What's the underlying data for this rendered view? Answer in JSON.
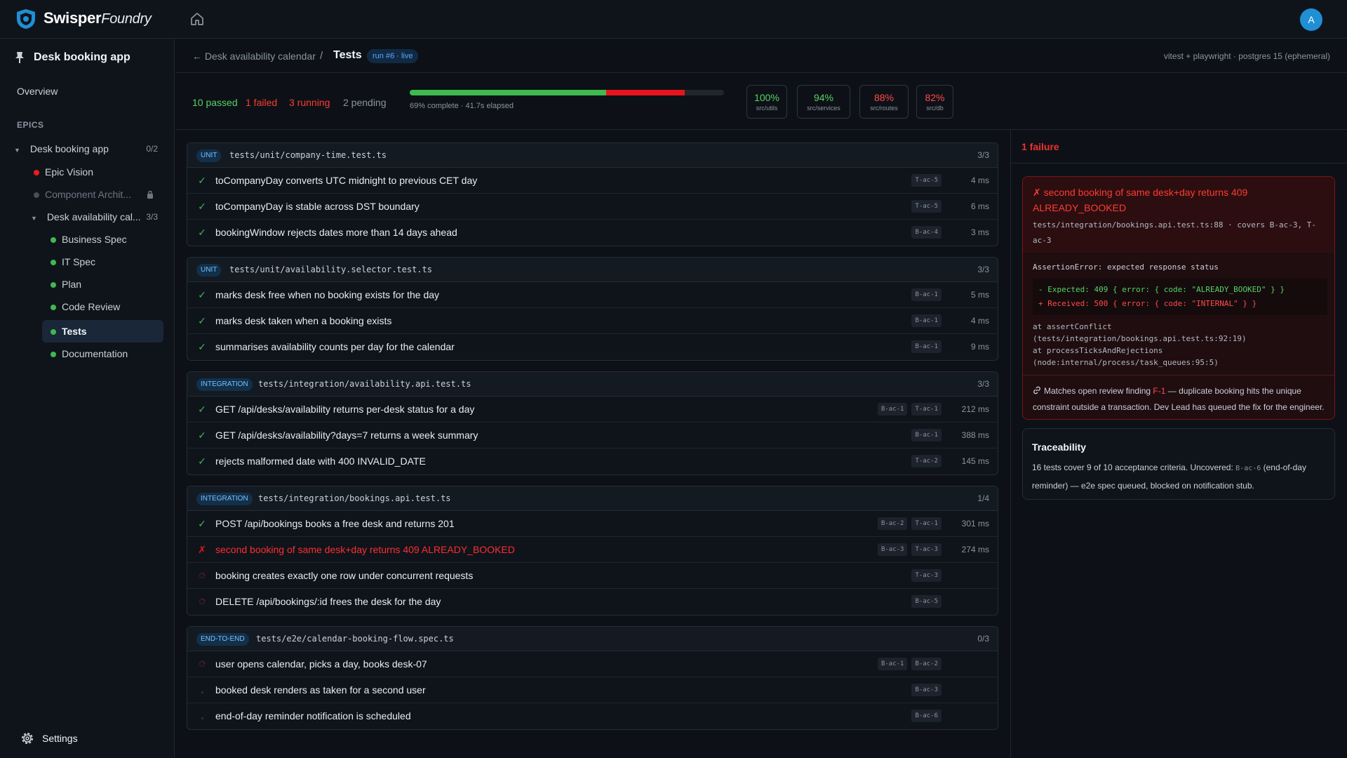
{
  "app": {
    "brand": "Swisper",
    "brand_sub": "Foundry",
    "avatar_initial": "A"
  },
  "sidebar": {
    "project_title": "Desk booking app",
    "overview": "Overview",
    "epics_heading": "EPICS",
    "epic_group": {
      "label": "Desk booking app",
      "count": "0/2"
    },
    "epics": [
      {
        "label": "Epic Vision",
        "status": "red"
      },
      {
        "label": "Component Archit...",
        "status": "locked"
      }
    ],
    "feature": {
      "label": "Desk availability cal...",
      "count": "3/3"
    },
    "feature_items": [
      {
        "label": "Business Spec"
      },
      {
        "label": "IT Spec"
      },
      {
        "label": "Plan"
      },
      {
        "label": "Code Review"
      },
      {
        "label": "Tests",
        "active": true
      },
      {
        "label": "Documentation"
      }
    ],
    "settings": "Settings"
  },
  "breadcrumb": {
    "back": "← Desk availability calendar",
    "sep": "/",
    "current": "Tests",
    "run_badge": "run #6 · live",
    "env": "vitest + playwright · postgres 15 (ephemeral)"
  },
  "summary": {
    "passed": "10 passed",
    "failed": "1 failed",
    "running": "3 running",
    "pending": "2 pending",
    "progress_text": "69% complete · 41.7s elapsed",
    "progress_pass_fraction": 0.625,
    "progress_fail_fraction": 0.25,
    "coverage": [
      {
        "pct": "100%",
        "label": "src/utils",
        "color": "#56d364"
      },
      {
        "pct": "94%",
        "label": "src/services",
        "color": "#56d364"
      },
      {
        "pct": "88%",
        "label": "src/routes",
        "color": "#ff4a4a"
      },
      {
        "pct": "82%",
        "label": "src/db",
        "color": "#ff4a4a"
      }
    ]
  },
  "groups": [
    {
      "type": "UNIT",
      "file": "tests/unit/company-time.test.ts",
      "count": "3/3",
      "tests": [
        {
          "status": "pass",
          "name": "toCompanyDay converts UTC midnight to previous CET day",
          "tags": [
            "T-ac-5"
          ],
          "duration": "4 ms"
        },
        {
          "status": "pass",
          "name": "toCompanyDay is stable across DST boundary",
          "tags": [
            "T-ac-5"
          ],
          "duration": "6 ms"
        },
        {
          "status": "pass",
          "name": "bookingWindow rejects dates more than 14 days ahead",
          "tags": [
            "B-ac-4"
          ],
          "duration": "3 ms"
        }
      ]
    },
    {
      "type": "UNIT",
      "file": "tests/unit/availability.selector.test.ts",
      "count": "3/3",
      "tests": [
        {
          "status": "pass",
          "name": "marks desk free when no booking exists for the day",
          "tags": [
            "B-ac-1"
          ],
          "duration": "5 ms"
        },
        {
          "status": "pass",
          "name": "marks desk taken when a booking exists",
          "tags": [
            "B-ac-1"
          ],
          "duration": "4 ms"
        },
        {
          "status": "pass",
          "name": "summarises availability counts per day for the calendar",
          "tags": [
            "B-ac-1"
          ],
          "duration": "9 ms"
        }
      ]
    },
    {
      "type": "INTEGRATION",
      "file": "tests/integration/availability.api.test.ts",
      "count": "3/3",
      "tests": [
        {
          "status": "pass",
          "name": "GET /api/desks/availability returns per-desk status for a day",
          "tags": [
            "B-ac-1",
            "T-ac-1"
          ],
          "duration": "212 ms"
        },
        {
          "status": "pass",
          "name": "GET /api/desks/availability?days=7 returns a week summary",
          "tags": [
            "B-ac-1"
          ],
          "duration": "388 ms"
        },
        {
          "status": "pass",
          "name": "rejects malformed date with 400 INVALID_DATE",
          "tags": [
            "T-ac-2"
          ],
          "duration": "145 ms"
        }
      ]
    },
    {
      "type": "INTEGRATION",
      "file": "tests/integration/bookings.api.test.ts",
      "count": "1/4",
      "tests": [
        {
          "status": "pass",
          "name": "POST /api/bookings books a free desk and returns 201",
          "tags": [
            "B-ac-2",
            "T-ac-1"
          ],
          "duration": "301 ms"
        },
        {
          "status": "fail",
          "name": "second booking of same desk+day returns 409 ALREADY_BOOKED",
          "tags": [
            "B-ac-3",
            "T-ac-3"
          ],
          "duration": "274 ms"
        },
        {
          "status": "running",
          "name": "booking creates exactly one row under concurrent requests",
          "tags": [
            "T-ac-3"
          ],
          "duration": ""
        },
        {
          "status": "running",
          "name": "DELETE /api/bookings/:id frees the desk for the day",
          "tags": [
            "B-ac-5"
          ],
          "duration": ""
        }
      ]
    },
    {
      "type": "END-TO-END",
      "file": "tests/e2e/calendar-booking-flow.spec.ts",
      "count": "0/3",
      "tests": [
        {
          "status": "running",
          "name": "user opens calendar, picks a day, books desk-07",
          "tags": [
            "B-ac-1",
            "B-ac-2"
          ],
          "duration": ""
        },
        {
          "status": "pending",
          "name": "booked desk renders as taken for a second user",
          "tags": [
            "B-ac-3"
          ],
          "duration": ""
        },
        {
          "status": "pending",
          "name": "end-of-day reminder notification is scheduled",
          "tags": [
            "B-ac-6"
          ],
          "duration": ""
        }
      ]
    }
  ],
  "failure_panel": {
    "title": "1 failure",
    "name": "✗ second booking of same desk+day returns 409 ALREADY_BOOKED",
    "location": "tests/integration/bookings.api.test.ts:88 · covers B-ac-3, T-ac-3",
    "error": "AssertionError: expected response status",
    "expected": "- Expected: 409 { error: { code: \"ALREADY_BOOKED\" } }",
    "received": "+ Received: 500 { error: { code: \"INTERNAL\" } }",
    "stack": "at assertConflict\n(tests/integration/bookings.api.test.ts:92:19)\nat processTicksAndRejections\n(node:internal/process/task_queues:95:5)",
    "note_prefix": "Matches open review finding ",
    "note_finding": "F-1",
    "note_suffix": " — duplicate booking hits the unique constraint outside a transaction. Dev Lead has queued the fix for the engineer."
  },
  "traceability": {
    "title": "Traceability",
    "text_prefix": "16 tests cover 9 of 10 acceptance criteria. Uncovered: ",
    "uncovered": "B-ac-6",
    "text_suffix": " (end-of-day reminder) — e2e spec queued, blocked on notification stub."
  },
  "colors": {
    "pass": "#3fb950",
    "fail": "#e8141d",
    "running": "#f0302c",
    "accent": "#1f8fd6"
  }
}
